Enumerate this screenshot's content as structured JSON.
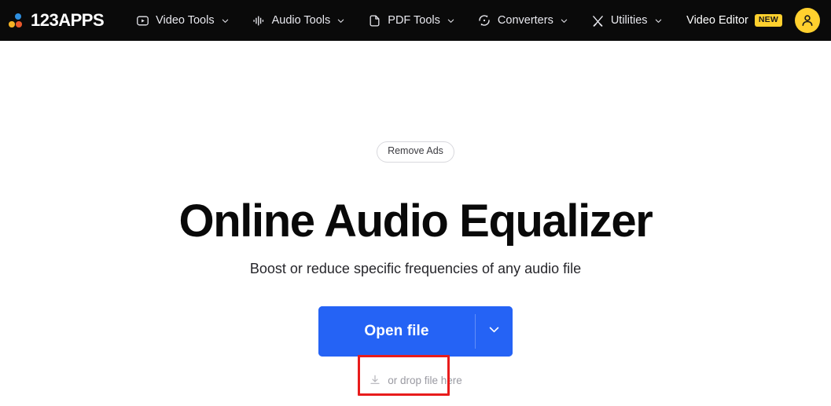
{
  "header": {
    "logo_text": "123APPS",
    "logo_icon": "three-dots-logo-icon",
    "nav": [
      {
        "label": "Video Tools",
        "icon": "video-play-icon"
      },
      {
        "label": "Audio Tools",
        "icon": "audio-waveform-icon"
      },
      {
        "label": "PDF Tools",
        "icon": "document-page-icon"
      },
      {
        "label": "Converters",
        "icon": "circular-arrows-convert-icon"
      },
      {
        "label": "Utilities",
        "icon": "crossed-tools-icon"
      }
    ],
    "video_editor_label": "Video Editor",
    "video_editor_badge": "NEW",
    "avatar_icon": "user-account-avatar-icon"
  },
  "main": {
    "remove_ads_label": "Remove Ads",
    "title": "Online Audio Equalizer",
    "subtitle": "Boost or reduce specific frequencies of any audio file",
    "open_file_label": "Open file",
    "open_file_caret_icon": "chevron-down-icon",
    "drop_hint": "or drop file here",
    "drop_icon": "download-arrow-icon"
  },
  "colors": {
    "header_bg": "#0a0a0a",
    "page_bg": "#ffffff",
    "accent_blue": "#2563f5",
    "badge_yellow": "#ffd02e",
    "annotation_red": "#e81c1c",
    "logo_dot_blue": "#2e8fe0",
    "logo_dot_yellow": "#f5b324",
    "logo_dot_red": "#e8582c",
    "muted_text": "#9a9aa2"
  }
}
